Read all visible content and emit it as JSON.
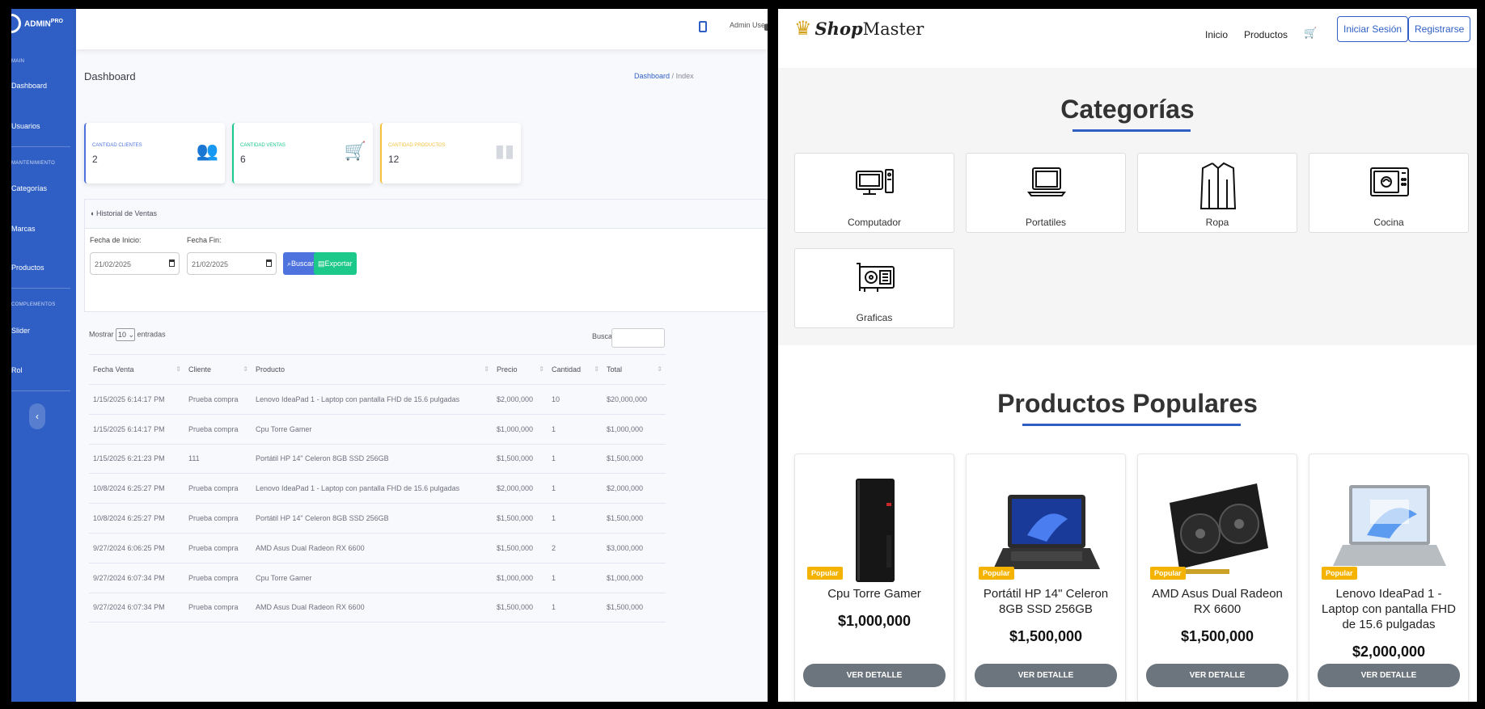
{
  "admin": {
    "brand": {
      "name": "ADMIN",
      "sup": "PRO"
    },
    "sidebar": {
      "headings": [
        "MAIN",
        "MANTENIMIENTO",
        "COMPLEMENTOS"
      ],
      "items": [
        {
          "label": "Dashboard"
        },
        {
          "label": "Usuarios"
        },
        {
          "label": "Categorías"
        },
        {
          "label": "Marcas"
        },
        {
          "label": "Productos"
        },
        {
          "label": "Slider"
        },
        {
          "label": "Rol"
        }
      ],
      "toggle_glyph": "‹"
    },
    "topbar": {
      "user": "Admin User"
    },
    "page_title": "Dashboard",
    "breadcrumb": {
      "first": "Dashboard",
      "sep": "/",
      "current": "Index"
    },
    "stats": [
      {
        "label": "CANTIDAD CLIENTES",
        "value": "2",
        "color": "#4e73df",
        "icon": "users-icon"
      },
      {
        "label": "CANTIDAD VENTAS",
        "value": "6",
        "color": "#1cc88a",
        "icon": "cart-icon"
      },
      {
        "label": "CANTIDAD PRODUCTOS",
        "value": "12",
        "color": "#f6c23e",
        "icon": "boxes-icon"
      }
    ],
    "history": {
      "title": "Historial de Ventas",
      "start_label": "Fecha de Inicio:",
      "end_label": "Fecha Fin:",
      "start_value": "21/02/2025",
      "end_value": "21/02/2025",
      "search_button": "Buscar",
      "export_button": "Exportar"
    },
    "datatable": {
      "show_label": "Mostrar",
      "length": "10",
      "entries_label": "entradas",
      "search_label": "Buscar:",
      "columns": [
        "Fecha Venta",
        "Cliente",
        "Producto",
        "Precio",
        "Cantidad",
        "Total"
      ],
      "rows": [
        [
          "1/15/2025 6:14:17 PM",
          "Prueba compra",
          "Lenovo IdeaPad 1 - Laptop con pantalla FHD de 15.6 pulgadas",
          "$2,000,000",
          "10",
          "$20,000,000"
        ],
        [
          "1/15/2025 6:14:17 PM",
          "Prueba compra",
          "Cpu Torre Gamer",
          "$1,000,000",
          "1",
          "$1,000,000"
        ],
        [
          "1/15/2025 6:21:23 PM",
          "111",
          "Portátil HP 14\" Celeron 8GB SSD 256GB",
          "$1,500,000",
          "1",
          "$1,500,000"
        ],
        [
          "10/8/2024 6:25:27 PM",
          "Prueba compra",
          "Lenovo IdeaPad 1 - Laptop con pantalla FHD de 15.6 pulgadas",
          "$2,000,000",
          "1",
          "$2,000,000"
        ],
        [
          "10/8/2024 6:25:27 PM",
          "Prueba compra",
          "Portátil HP 14\" Celeron 8GB SSD 256GB",
          "$1,500,000",
          "1",
          "$1,500,000"
        ],
        [
          "9/27/2024 6:06:25 PM",
          "Prueba compra",
          "AMD Asus Dual Radeon RX 6600",
          "$1,500,000",
          "2",
          "$3,000,000"
        ],
        [
          "9/27/2024 6:07:34 PM",
          "Prueba compra",
          "Cpu Torre Gamer",
          "$1,000,000",
          "1",
          "$1,000,000"
        ],
        [
          "9/27/2024 6:07:34 PM",
          "Prueba compra",
          "AMD Asus Dual Radeon RX 6600",
          "$1,500,000",
          "1",
          "$1,500,000"
        ]
      ]
    }
  },
  "shop": {
    "logo": {
      "bold": "Shop",
      "rest": "Master"
    },
    "nav": {
      "home": "Inicio",
      "products": "Productos",
      "login": "Iniciar Sesión",
      "register": "Registrarse"
    },
    "categories_title": "Categorías",
    "categories": [
      {
        "name": "Computador",
        "icon": "computer-icon"
      },
      {
        "name": "Portatiles",
        "icon": "laptop-icon"
      },
      {
        "name": "Ropa",
        "icon": "shirt-icon"
      },
      {
        "name": "Cocina",
        "icon": "microwave-icon"
      },
      {
        "name": "Graficas",
        "icon": "gpu-icon"
      }
    ],
    "popular_title": "Productos Populares",
    "products": [
      {
        "name": "Cpu Torre Gamer",
        "price": "$1,000,000",
        "badge": "Popular",
        "button": "VER DETALLE",
        "image": "pc-tower-image"
      },
      {
        "name": "Portátil HP 14\" Celeron 8GB SSD 256GB",
        "price": "$1,500,000",
        "badge": "Popular",
        "button": "VER DETALLE",
        "image": "laptop-hp-image"
      },
      {
        "name": "AMD Asus Dual Radeon RX 6600",
        "price": "$1,500,000",
        "badge": "Popular",
        "button": "VER DETALLE",
        "image": "gpu-card-image"
      },
      {
        "name": "Lenovo IdeaPad 1 - Laptop con pantalla FHD de 15.6 pulgadas",
        "price": "$2,000,000",
        "badge": "Popular",
        "button": "VER DETALLE",
        "image": "laptop-lenovo-image"
      }
    ]
  }
}
